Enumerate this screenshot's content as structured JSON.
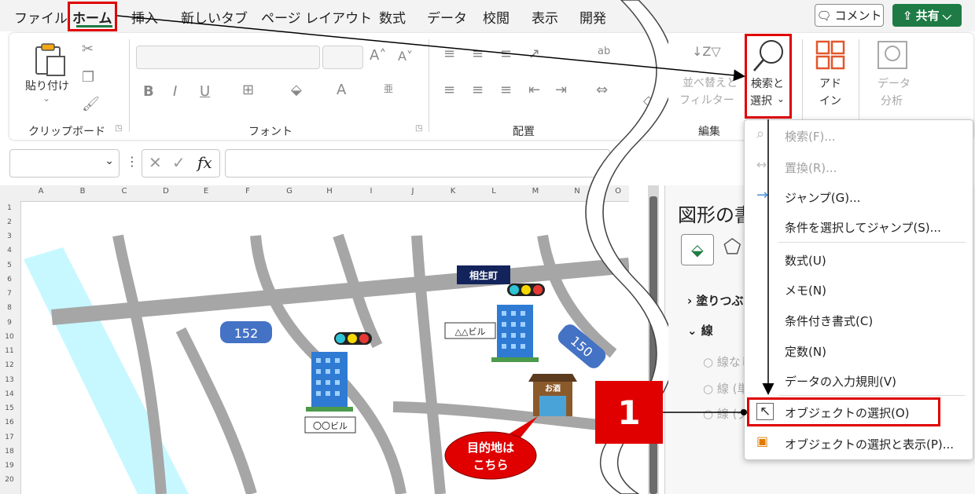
{
  "menu_tabs": [
    "ファイル",
    "ホーム",
    "挿入",
    "新しいタブ",
    "ページ レイアウト",
    "数式",
    "データ",
    "校閲",
    "表示",
    "開発"
  ],
  "header_buttons": {
    "comment": "コメント",
    "share": "共有"
  },
  "ribbon": {
    "clipboard": {
      "paste": "貼り付け",
      "label": "クリップボード"
    },
    "font": {
      "label": "フォント"
    },
    "alignment": {
      "label": "配置"
    },
    "editing": {
      "sort_line1": "並べ替えと",
      "sort_line2": "フィルター",
      "search_line1": "検索と",
      "search_line2": "選択",
      "label": "編集"
    },
    "addin": {
      "line1": "アド",
      "line2": "イン"
    },
    "analysis": {
      "line1": "データ",
      "line2": "分析"
    }
  },
  "grid": {
    "columns": [
      "A",
      "B",
      "C",
      "D",
      "E",
      "F",
      "G",
      "H",
      "I",
      "J",
      "K",
      "L",
      "M",
      "N",
      "O"
    ],
    "rows": [
      "1",
      "2",
      "3",
      "4",
      "5",
      "6",
      "7",
      "8",
      "9",
      "10",
      "11",
      "12",
      "13",
      "14",
      "15",
      "16",
      "17",
      "18",
      "19",
      "20"
    ]
  },
  "map": {
    "route_152": "152",
    "route_150": "150",
    "station": "相生町",
    "building_triangle": "△△ビル",
    "building_circle": "〇〇ビル",
    "shop_sign": "お酒",
    "destination_line1": "目的地は",
    "destination_line2": "こちら"
  },
  "pane": {
    "title": "図形の書式設定",
    "fill": "塗りつぶし",
    "line": "線",
    "opt1": "線なし",
    "opt2": "線 (単色)",
    "opt3": "線 (グラデーション)"
  },
  "dropdown": {
    "find": "検索(F)...",
    "replace": "置換(R)...",
    "goto": "ジャンプ(G)...",
    "goto_special": "条件を選択してジャンプ(S)...",
    "formulas": "数式(U)",
    "notes": "メモ(N)",
    "cond_format": "条件付き書式(C)",
    "constants": "定数(N)",
    "validation": "データの入力規則(V)",
    "select_objects": "オブジェクトの選択(O)",
    "selection_pane": "オブジェクトの選択と表示(P)..."
  },
  "callout_step": "1",
  "colors": {
    "accent_green": "#1e7b45",
    "highlight_red": "#e00000",
    "road": "#a6a6a6",
    "route_sign": "#4472c4",
    "river": "#c7f8ff"
  }
}
